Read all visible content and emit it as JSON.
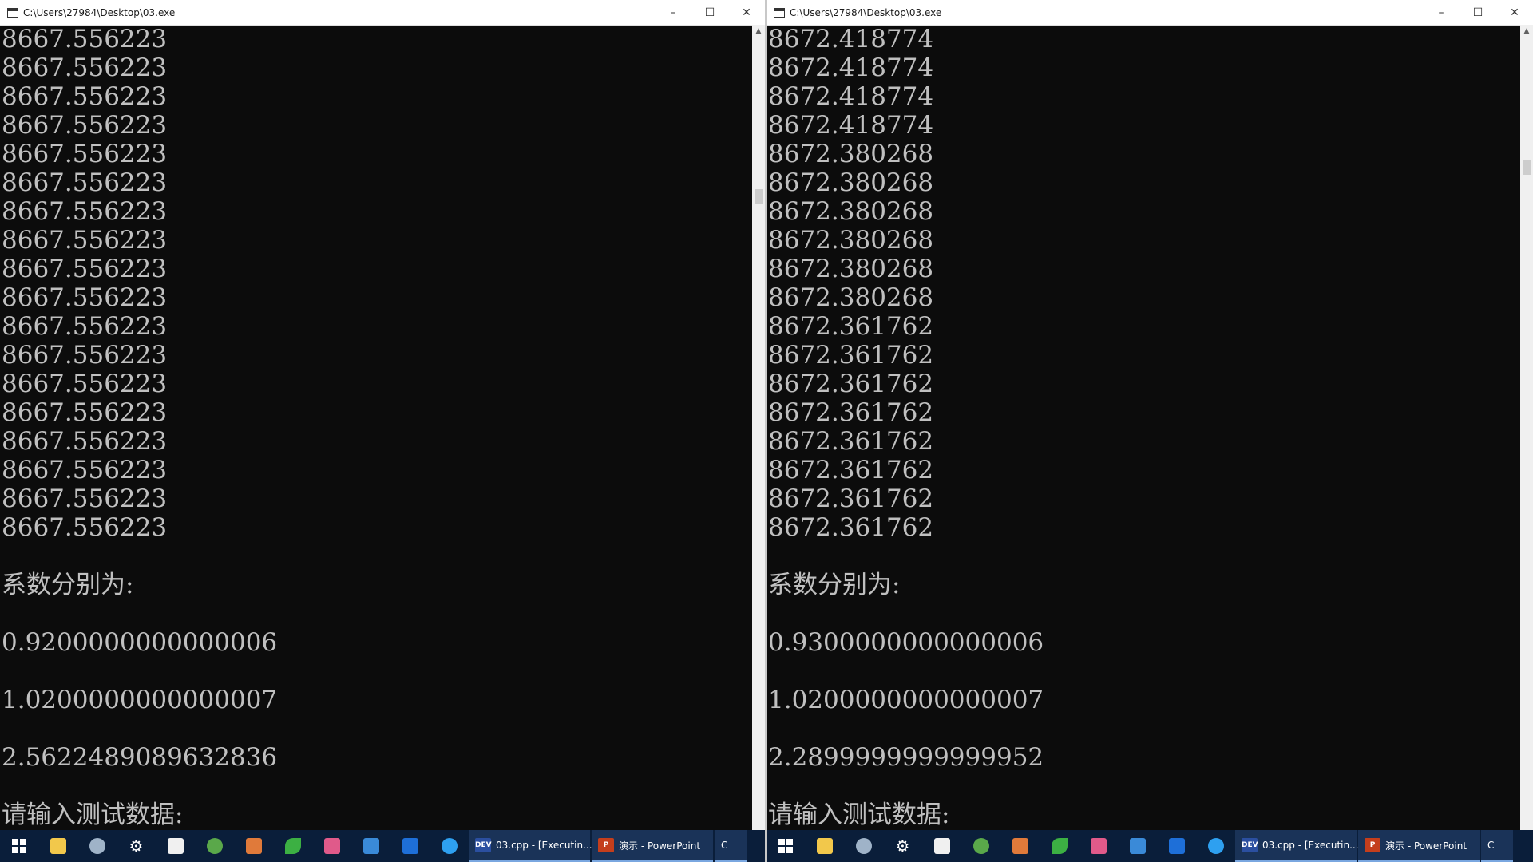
{
  "left": {
    "title": "C:\\Users\\27984\\Desktop\\03.exe",
    "values": [
      "8667.556223",
      "8667.556223",
      "8667.556223",
      "8667.556223",
      "8667.556223",
      "8667.556223",
      "8667.556223",
      "8667.556223",
      "8667.556223",
      "8667.556223",
      "8667.556223",
      "8667.556223",
      "8667.556223",
      "8667.556223",
      "8667.556223",
      "8667.556223",
      "8667.556223",
      "8667.556223"
    ],
    "coef_label": "系数分别为:",
    "coef": [
      "0.9200000000000006",
      "1.0200000000000007",
      "2.5622489089632836"
    ],
    "prompt": "请输入测试数据:"
  },
  "right": {
    "title": "C:\\Users\\27984\\Desktop\\03.exe",
    "values": [
      "8672.418774",
      "8672.418774",
      "8672.418774",
      "8672.418774",
      "8672.380268",
      "8672.380268",
      "8672.380268",
      "8672.380268",
      "8672.380268",
      "8672.380268",
      "8672.361762",
      "8672.361762",
      "8672.361762",
      "8672.361762",
      "8672.361762",
      "8672.361762",
      "8672.361762",
      "8672.361762"
    ],
    "coef_label": "系数分别为:",
    "coef": [
      "0.9300000000000006",
      "1.0200000000000007",
      "2.2899999999999952"
    ],
    "prompt": "请输入测试数据:"
  },
  "window_controls": {
    "minimize": "–",
    "maximize": "☐",
    "close": "✕"
  },
  "taskbar": {
    "tasks": [
      {
        "badge": "DEV",
        "label": "03.cpp - [Executin..."
      },
      {
        "badge": "P",
        "label": "演示 - PowerPoint"
      },
      {
        "badge": "",
        "label": "C"
      }
    ],
    "icons": [
      "file-explorer-icon",
      "mail-icon",
      "settings-icon",
      "store-icon",
      "app-green-icon",
      "app-grid-icon",
      "app-leaf-icon",
      "bilibili-icon",
      "app-blue-icon",
      "app-star-icon",
      "browser-icon"
    ],
    "colors": {
      "taskbar": "#0a1e3a",
      "dev_badge": "#2b4fa0",
      "ppt_badge": "#c43e1c"
    }
  }
}
